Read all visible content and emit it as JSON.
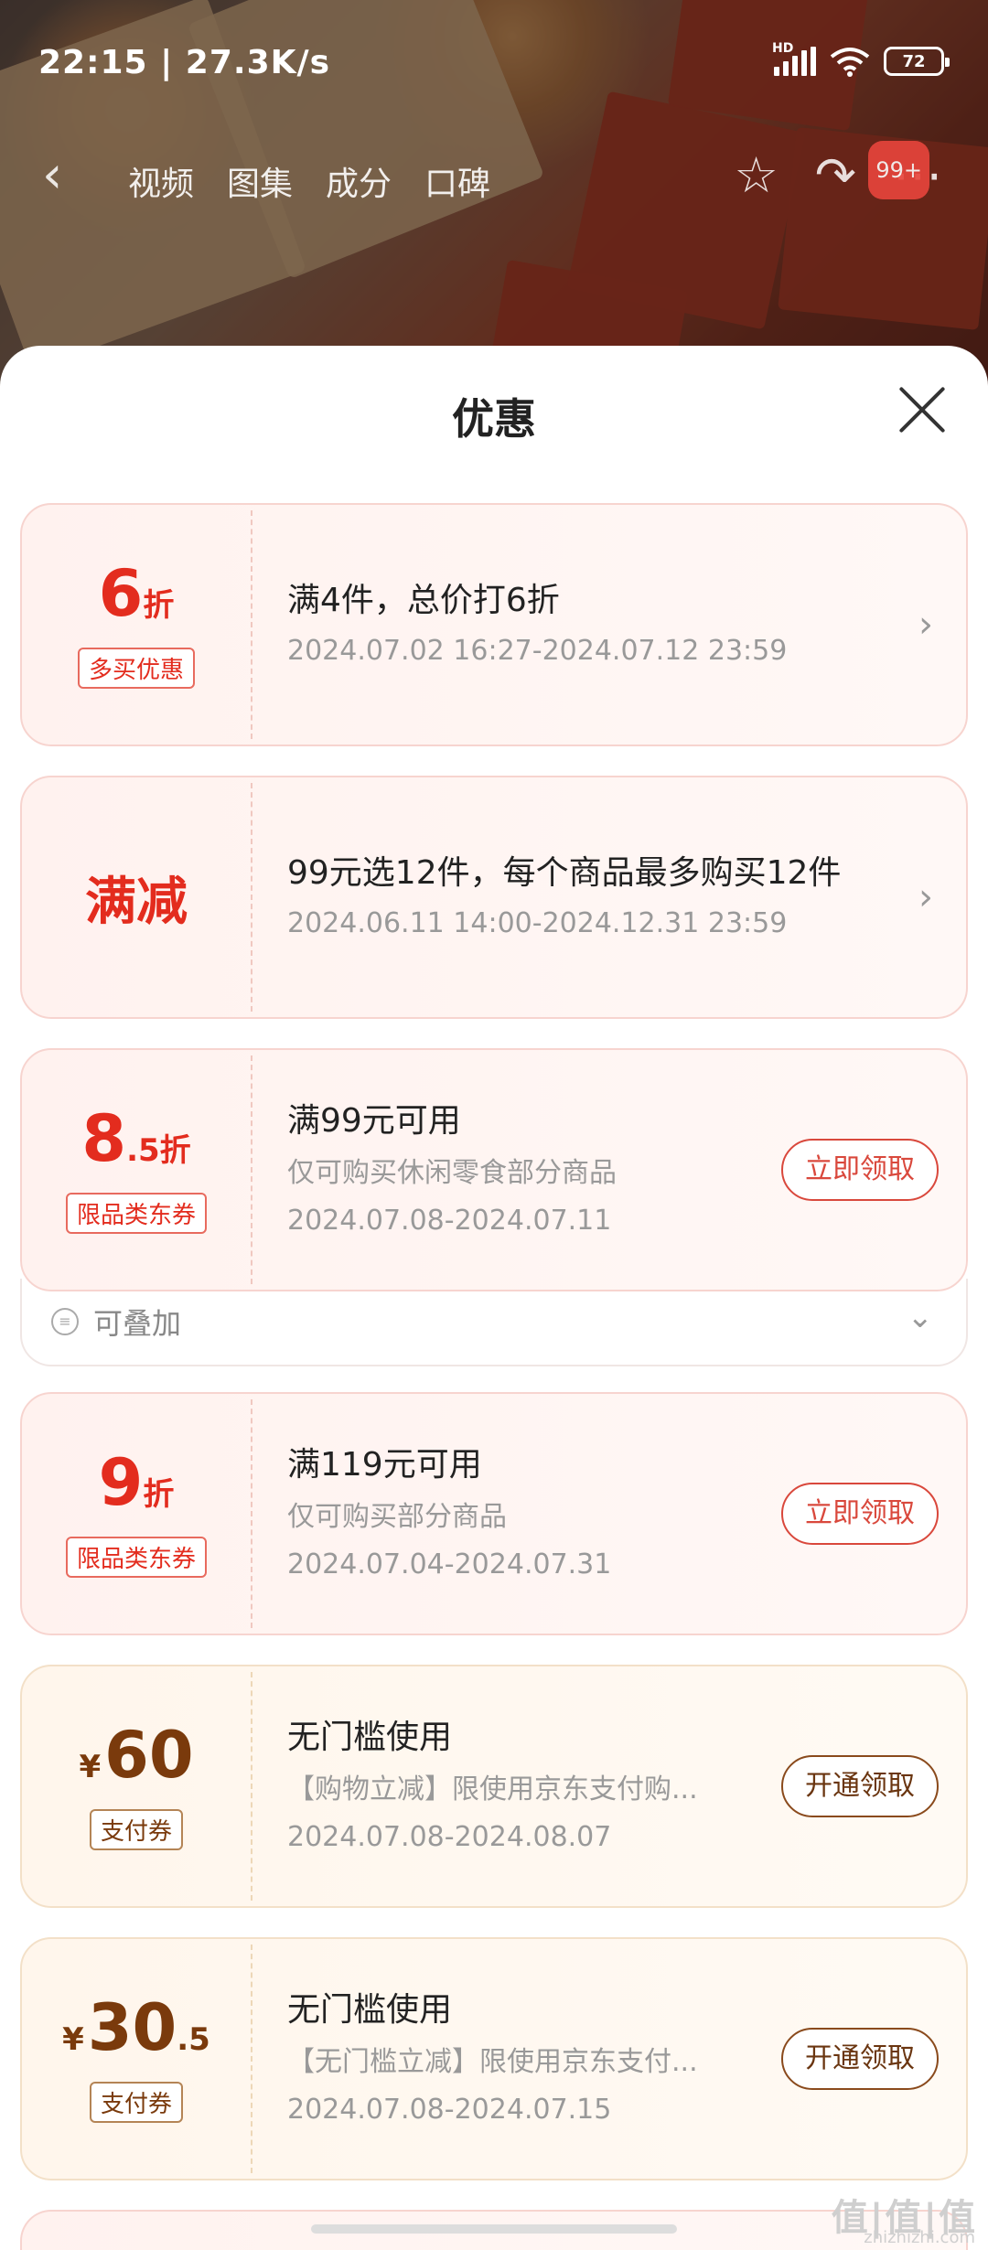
{
  "status_bar": {
    "time": "22:15 | 27.3K/s",
    "battery": "72",
    "network": "HD"
  },
  "nav": {
    "tabs": [
      "视频",
      "图集",
      "成分",
      "口碑"
    ],
    "cart_badge": "99+"
  },
  "sheet": {
    "title": "优惠"
  },
  "coupons": [
    {
      "value": "6",
      "unit": "折",
      "tag": "多买优惠",
      "title": "满4件，总价打6折",
      "date": "2024.07.02 16:27-2024.07.12 23:59"
    },
    {
      "label": "满减",
      "title": "99元选12件，每个商品最多购买12件",
      "date": "2024.06.11 14:00-2024.12.31 23:59"
    },
    {
      "value": "8",
      "unit_small": ".5",
      "unit": "折",
      "tag": "限品类东券",
      "title": "满99元可用",
      "subtitle": "仅可购买休闲零食部分商品",
      "date": "2024.07.08-2024.07.11",
      "button": "立即领取",
      "stack_label": "可叠加"
    },
    {
      "value": "9",
      "unit": "折",
      "tag": "限品类东券",
      "title": "满119元可用",
      "subtitle": "仅可购买部分商品",
      "date": "2024.07.04-2024.07.31",
      "button": "立即领取"
    },
    {
      "currency": "¥",
      "value": "60",
      "tag": "支付券",
      "title": "无门槛使用",
      "subtitle": "【购物立减】限使用京东支付购...",
      "date": "2024.07.08-2024.08.07",
      "button": "开通领取"
    },
    {
      "currency": "¥",
      "value": "30",
      "unit_small": ".5",
      "tag": "支付券",
      "title": "无门槛使用",
      "subtitle": "【无门槛立减】限使用京东支付...",
      "date": "2024.07.08-2024.07.15",
      "button": "开通领取"
    }
  ],
  "watermark": {
    "text": "值|值|值",
    "site": "zhizhizhi.com"
  },
  "colors": {
    "accent_red": "#e32c1e",
    "gold_text": "#7a3a0c"
  }
}
